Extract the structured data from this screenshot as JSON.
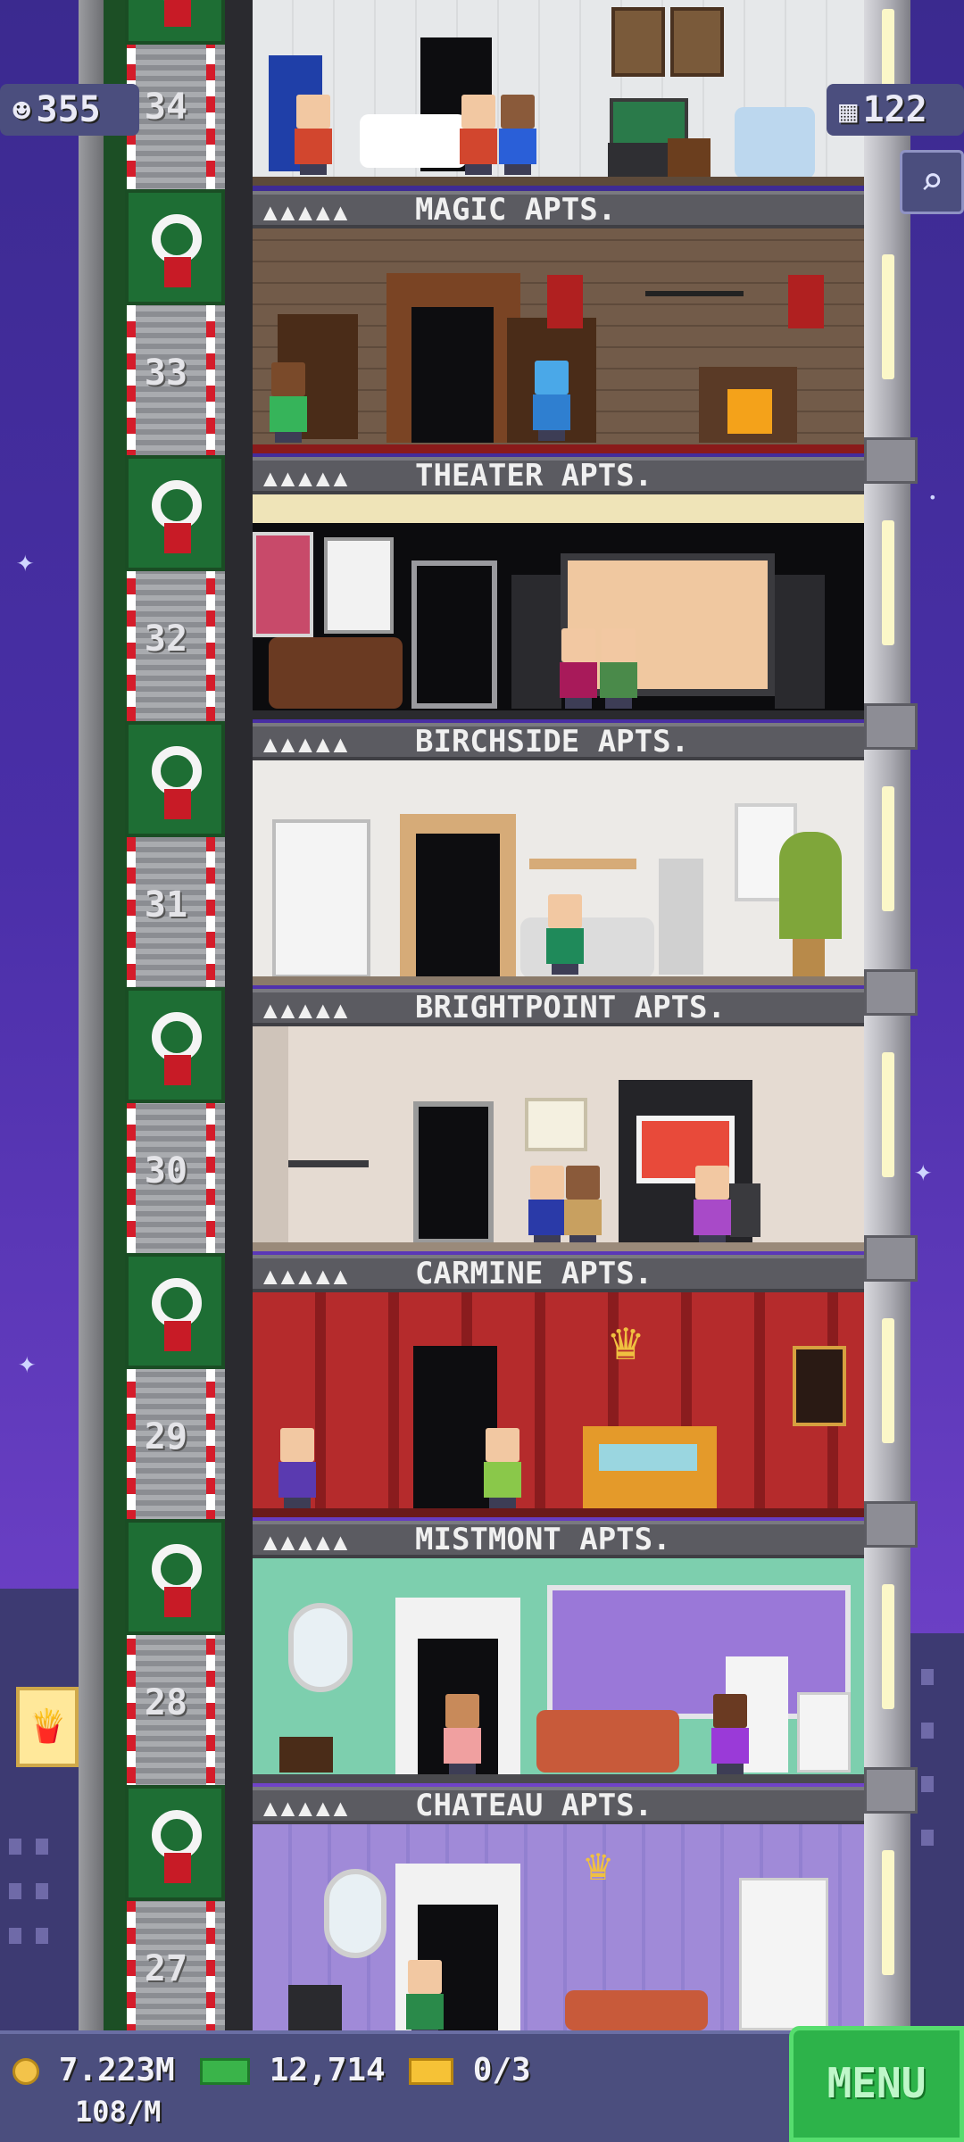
{
  "top": {
    "population": "355",
    "floors": "122"
  },
  "icons": {
    "population": "person-icon",
    "floors": "building-grid-icon",
    "search": "magnifier-icon",
    "coin": "coin-icon",
    "bux": "tower-bux-icon",
    "ticket": "golden-ticket-icon",
    "food": "fries-icon"
  },
  "floors": [
    {
      "number": "34",
      "sign": "MAGIC APTS."
    },
    {
      "number": "33",
      "sign": "THEATER APTS."
    },
    {
      "number": "32",
      "sign": "BIRCHSIDE APTS."
    },
    {
      "number": "31",
      "sign": "BRIGHTPOINT APTS."
    },
    {
      "number": "30",
      "sign": "CARMINE APTS."
    },
    {
      "number": "29",
      "sign": "MISTMONT APTS."
    },
    {
      "number": "28",
      "sign": "CHATEAU APTS."
    },
    {
      "number": "27",
      "sign": ""
    }
  ],
  "bottom": {
    "coins": "7.223M",
    "coin_rate": "108/M",
    "bux": "12,714",
    "tickets": "0/3",
    "menu": "MENU"
  },
  "colors": {
    "sky": "#4a2fa8",
    "hud": "#4b4e7e",
    "menu_button": "#2db34a"
  }
}
